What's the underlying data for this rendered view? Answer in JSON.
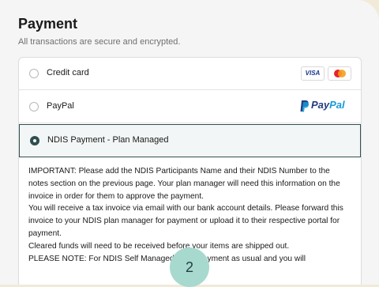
{
  "payment": {
    "title": "Payment",
    "subtitle": "All transactions are secure and encrypted."
  },
  "methods": [
    {
      "label": "Credit card",
      "selected": false,
      "icons": [
        "visa-icon",
        "mastercard-icon"
      ]
    },
    {
      "label": "PayPal",
      "selected": false,
      "icons": [
        "paypal-logo"
      ]
    },
    {
      "label": "NDIS Payment - Plan Managed",
      "selected": true
    }
  ],
  "brands": {
    "visa": "VISA",
    "paypal_part1": "Pay",
    "paypal_part2": "Pal"
  },
  "ndis_info": {
    "line1": "IMPORTANT: Please add the NDIS Participants Name and their NDIS Number to the notes section on the previous page. Your plan manager will need this information on the invoice in order for them to approve the payment.",
    "line2": "You will receive a tax invoice via email with our bank account details. Please forward this invoice to your NDIS plan manager for payment or upload it to their respective portal for payment.",
    "line3": "Cleared funds will need to be received before your items are shipped out.",
    "line4": "PLEASE NOTE: For NDIS Self Managed make payment as usual and you will"
  },
  "badge": {
    "text": "2"
  },
  "colors": {
    "accent": "#2f4f4f",
    "background": "#f2ead9",
    "badge": "#a7d9cf",
    "paypal_dark": "#253b80",
    "paypal_light": "#179bd7"
  }
}
